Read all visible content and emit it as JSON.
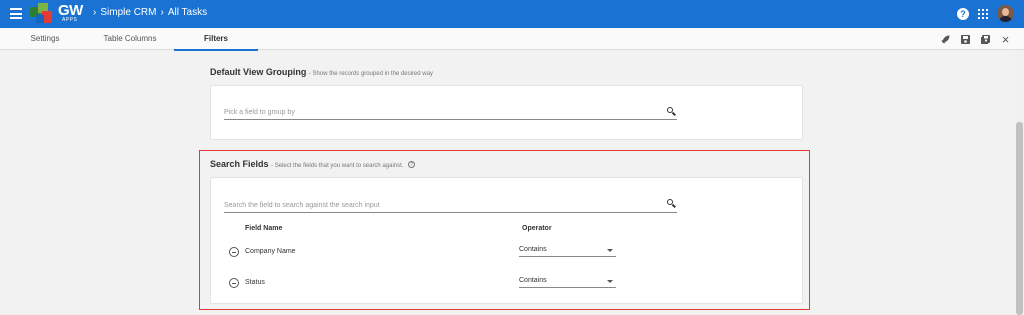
{
  "app": {
    "logo_text": "GW",
    "logo_sub": "APPS",
    "breadcrumbs": [
      "Simple CRM",
      "All Tasks"
    ],
    "help_label": "?"
  },
  "tabs": [
    {
      "label": "Settings",
      "active": false
    },
    {
      "label": "Table Columns",
      "active": false
    },
    {
      "label": "Filters",
      "active": true
    }
  ],
  "toolbar_icons": [
    "rocket-icon",
    "save-icon",
    "save-as-icon",
    "close-icon"
  ],
  "grouping": {
    "title": "Default View Grouping",
    "description": "- Show the records grouped in the desired way",
    "placeholder": "Pick a field to group by"
  },
  "search_fields": {
    "title": "Search Fields",
    "description": "- Select the fields that you want to search against.",
    "placeholder": "Search the field to search against the search input",
    "columns": {
      "field": "Field Name",
      "operator": "Operator"
    },
    "rows": [
      {
        "field": "Company Name",
        "operator": "Contains"
      },
      {
        "field": "Status",
        "operator": "Contains"
      }
    ]
  },
  "colors": {
    "primary": "#1a73d2",
    "highlight": "#e53935"
  }
}
